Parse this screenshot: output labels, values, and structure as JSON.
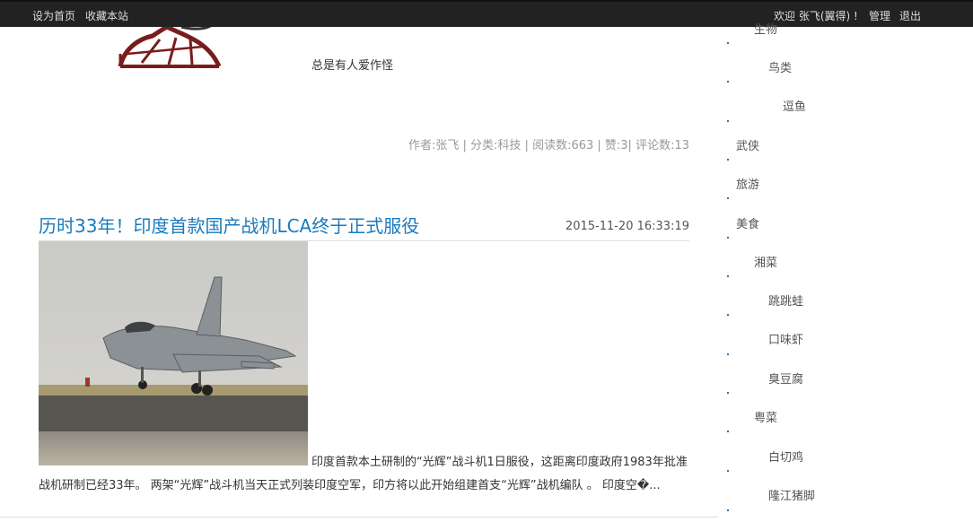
{
  "topbar": {
    "home": "设为首页",
    "favorite": "收藏本站",
    "welcome": "欢迎 张飞(翼得) !",
    "admin": "管理",
    "logout": "退出"
  },
  "previous_post": {
    "text": "总是有人爱作怪",
    "meta": "作者:张飞 | 分类:科技 | 阅读数:663 | 赞:3| 评论数:13"
  },
  "article": {
    "title": "历时33年！印度首款国产战机LCA终于正式服役",
    "date": "2015-11-20 16:33:19",
    "excerpt": "印度首款本土研制的“光辉”战斗机1日服役，这距离印度政府1983年批准战机研制已经33年。 两架“光辉”战斗机当天正式列装印度空军，印方将以此开始组建首支“光辉”战机编队 。 印度空�..."
  },
  "sidebar": {
    "categories": [
      {
        "label": "生物"
      },
      {
        "label": "鸟类"
      },
      {
        "label": "逗鱼"
      },
      {
        "label": "武侠"
      },
      {
        "label": "旅游"
      },
      {
        "label": "美食"
      },
      {
        "label": "湘菜"
      },
      {
        "label": "跳跳蛙"
      },
      {
        "label": "口味虾"
      },
      {
        "label": "臭豆腐"
      },
      {
        "label": "粤菜"
      },
      {
        "label": "白切鸡"
      },
      {
        "label": "隆江猪脚"
      }
    ]
  }
}
